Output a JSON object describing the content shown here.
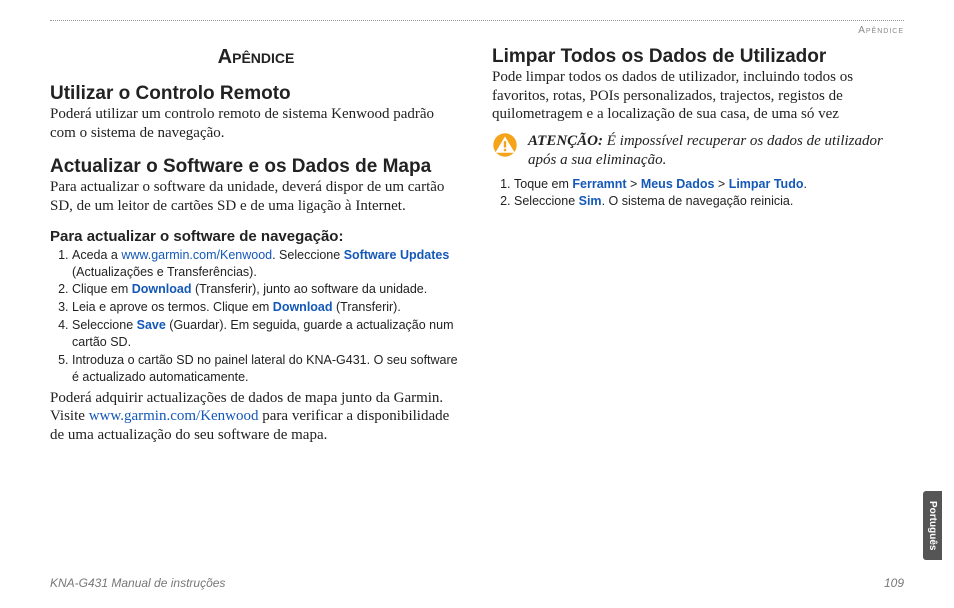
{
  "header": {
    "label": "Apêndice"
  },
  "chapter_title": "Apêndice",
  "left": {
    "s1": {
      "title": "Utilizar o Controlo Remoto",
      "body": "Poderá utilizar um controlo remoto de sistema Kenwood padrão com o sistema de navegação."
    },
    "s2": {
      "title": "Actualizar o Software e os Dados de Mapa",
      "body": "Para actualizar o software da unidade, deverá dispor de um cartão SD, de um leitor de cartões SD e de uma ligação à Internet.",
      "subtitle": "Para actualizar o software de navegação:",
      "steps": {
        "i1a": "Aceda a ",
        "i1_link": "www.garmin.com/Kenwood",
        "i1b": ". Seleccione ",
        "i1_bold": "Software Updates",
        "i1c": " (Actualizações e Transferências).",
        "i2a": "Clique em ",
        "i2_bold": "Download",
        "i2b": " (Transferir), junto ao software da unidade.",
        "i3a": "Leia e aprove os termos. Clique em ",
        "i3_bold": "Download",
        "i3b": " (Transferir).",
        "i4a": "Seleccione ",
        "i4_bold": "Save",
        "i4b": " (Guardar). Em seguida, guarde a actualização num cartão SD.",
        "i5": "Introduza o cartão SD no painel lateral do KNA-G431. O seu software é actualizado automaticamente."
      },
      "after_a": "Poderá adquirir actualizações de dados de mapa junto da Garmin. Visite ",
      "after_link": "www.garmin.com/Kenwood",
      "after_b": " para verificar a disponibilidade de uma actualização do seu software de mapa."
    }
  },
  "right": {
    "s1": {
      "title": "Limpar Todos os Dados de Utilizador",
      "body": "Pode limpar todos os dados de utilizador, incluindo todos os favoritos, rotas, POIs personalizados, trajectos, registos de quilometragem e a localização de sua casa, de uma só vez",
      "caution_label": "ATENÇÃO:",
      "caution_text": " É impossível recuperar os dados de utilizador após a sua eliminação.",
      "steps": {
        "i1a": "Toque em ",
        "i1_b1": "Ferramnt",
        "i1_gt1": " > ",
        "i1_b2": "Meus Dados",
        "i1_gt2": " > ",
        "i1_b3": "Limpar Tudo",
        "i1_end": ".",
        "i2a": "Seleccione ",
        "i2_b": "Sim",
        "i2b": ". O sistema de navegação reinicia."
      }
    }
  },
  "footer": {
    "left": "KNA-G431 Manual de instruções",
    "right": "109"
  },
  "side_tab": "Português"
}
